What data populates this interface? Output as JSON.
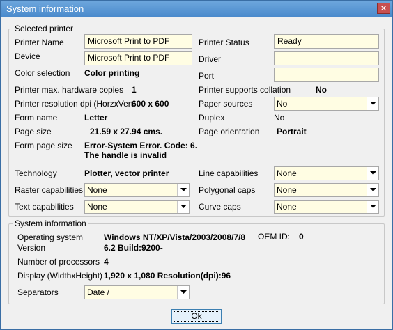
{
  "window": {
    "title": "System information",
    "close_glyph": "✕"
  },
  "printer_group": {
    "legend": "Selected printer",
    "printer_name_label": "Printer Name",
    "printer_name_value": "Microsoft Print to PDF",
    "device_label": "Device",
    "device_value": "Microsoft Print to PDF",
    "color_selection_label": "Color selection",
    "color_selection_value": "Color printing",
    "max_copies_label": "Printer max. hardware copies",
    "max_copies_value": "1",
    "resolution_label": "Printer resolution dpi (HorzxVert",
    "resolution_value": "600 x 600",
    "form_name_label": "Form name",
    "form_name_value": "Letter",
    "page_size_label": "Page size",
    "page_size_value": "21.59 x 27.94 cms.",
    "form_page_size_label": "Form page size",
    "form_page_size_value_line1": "Error-System Error.  Code: 6.",
    "form_page_size_value_line2": "The handle is invalid",
    "technology_label": "Technology",
    "technology_value": "Plotter, vector printer",
    "raster_label": "Raster capabilities",
    "raster_value": "None",
    "text_caps_label": "Text capabilities",
    "text_caps_value": "None",
    "status_label": "Printer Status",
    "status_value": "Ready",
    "driver_label": "Driver",
    "driver_value": "",
    "port_label": "Port",
    "port_value": "",
    "collation_label": "Printer supports collation",
    "collation_value": "No",
    "paper_sources_label": "Paper sources",
    "paper_sources_value": "No",
    "duplex_label": "Duplex",
    "duplex_value": "No",
    "orientation_label": "Page orientation",
    "orientation_value": "Portrait",
    "line_caps_label": "Line capabilities",
    "line_caps_value": "None",
    "polygonal_label": "Polygonal caps",
    "polygonal_value": "None",
    "curve_label": "Curve caps",
    "curve_value": "None"
  },
  "system_group": {
    "legend": "System information",
    "os_label": "Operating system",
    "os_value": "Windows NT/XP/Vista/2003/2008/7/8",
    "oem_label": "OEM ID:",
    "oem_value": "0",
    "version_label": "Version",
    "version_value": "6.2 Build:9200-",
    "processors_label": "Number of processors",
    "processors_value": "4",
    "display_label": "Display (WidthxHeight)",
    "display_value": "1,920 x 1,080 Resolution(dpi):96",
    "separators_label": "Separators",
    "separators_value": "Date /"
  },
  "buttons": {
    "ok_label": "Ok"
  },
  "icons": {
    "dropdown": "chevron-down-icon",
    "close": "close-icon"
  }
}
